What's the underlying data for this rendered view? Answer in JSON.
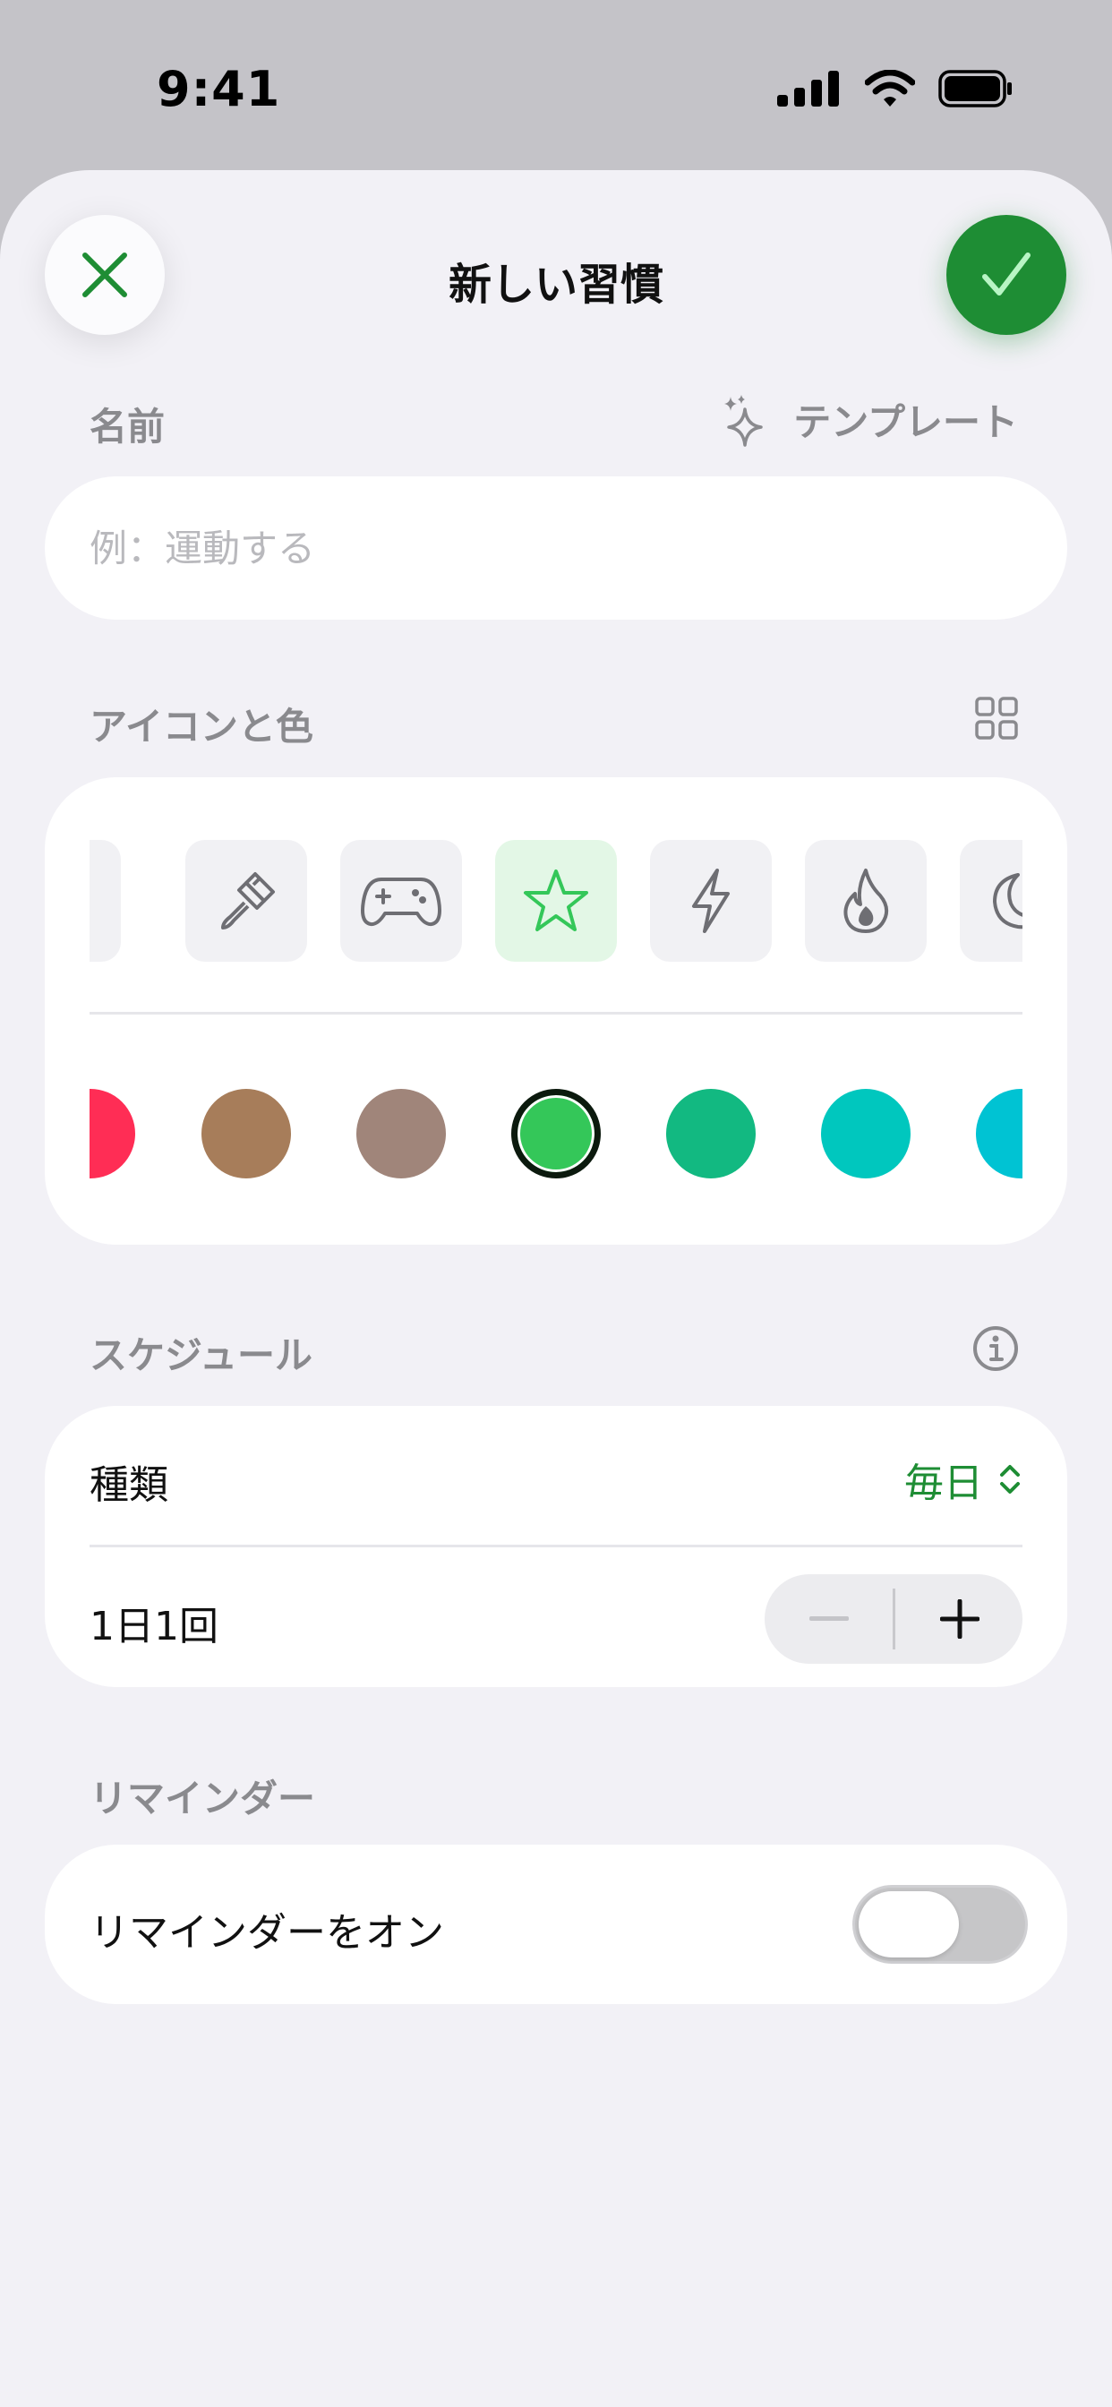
{
  "status_bar": {
    "time": "9:41"
  },
  "header": {
    "title": "新しい習慣"
  },
  "name_section": {
    "label": "名前",
    "template_label": "テンプレート",
    "placeholder": "例：運動する",
    "value": ""
  },
  "icon_section": {
    "label": "アイコンと色",
    "icons": [
      "camera-icon",
      "paintbrush-icon",
      "gamecontroller-icon",
      "star-icon",
      "bolt-icon",
      "flame-icon",
      "moon-icon"
    ],
    "selected_icon": "star-icon",
    "colors": [
      "#ff2d55",
      "#a77d5a",
      "#a0857a",
      "#34c759",
      "#12b981",
      "#00c7be",
      "#00c3d3"
    ],
    "selected_color": "#34c759"
  },
  "schedule_section": {
    "label": "スケジュール",
    "kind_label": "種類",
    "kind_value": "毎日",
    "frequency_label": "1日1回",
    "minus": "−",
    "plus": "+"
  },
  "reminder_section": {
    "label": "リマインダー",
    "toggle_label": "リマインダーをオン",
    "enabled": false
  },
  "colors": {
    "accent": "#1e8d34",
    "label_gray": "#8a8a8e",
    "sheet_bg": "#f2f1f6"
  }
}
